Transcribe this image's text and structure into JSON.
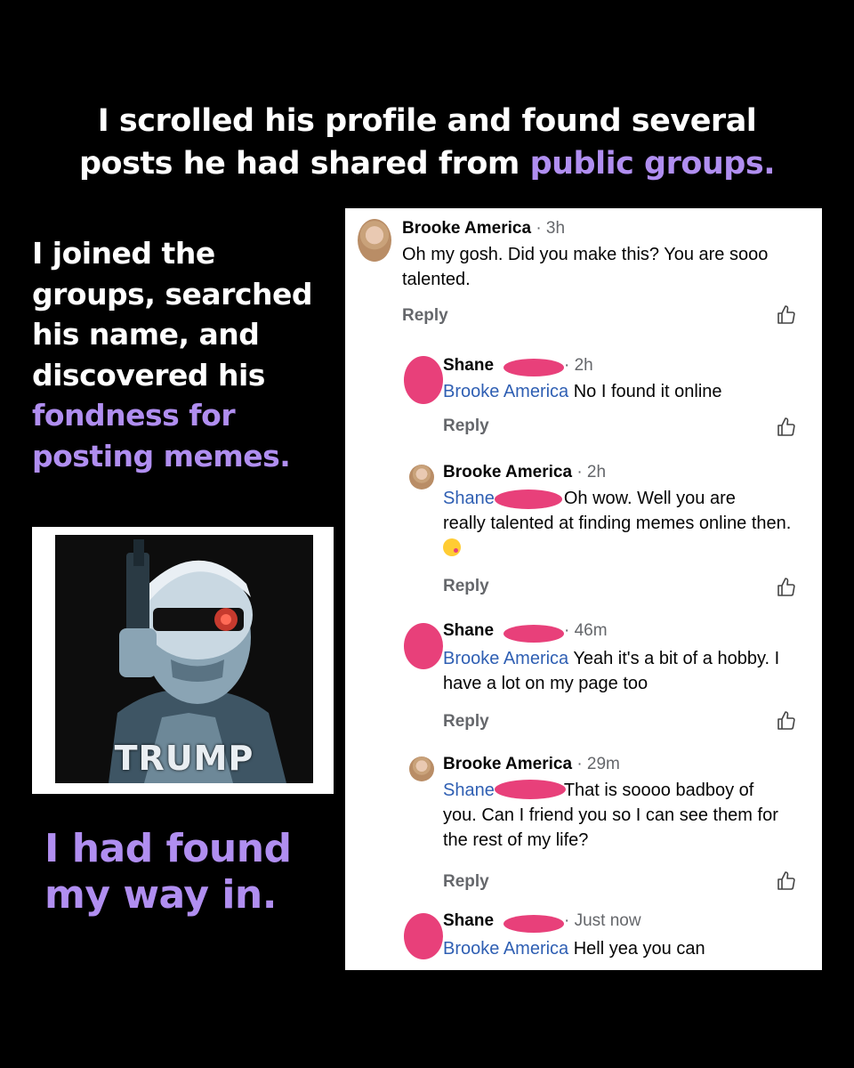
{
  "headline": {
    "line1": "I scrolled his profile and found several",
    "line2_plain": "posts he had shared from ",
    "line2_accent": "public groups."
  },
  "left_text": {
    "plain": "I joined the groups, searched his name, and discovered his ",
    "accent": "fondness for posting memes."
  },
  "closing": "I had found my way in.",
  "meme": {
    "caption": "TRUMP"
  },
  "colors": {
    "accent": "#b08ef0",
    "mention": "#2f5fb3",
    "redaction": "#e8407a"
  },
  "comments": [
    {
      "name": "Brooke America",
      "time": "· 3h",
      "mention": "",
      "text": "Oh my gosh. Did you make this? You are sooo talented.",
      "reply": "Reply",
      "icon": "thumbs-up-icon"
    },
    {
      "name": "Shane",
      "time": "· 2h",
      "mention": "Brooke America",
      "text": "No I found it online",
      "reply": "Reply",
      "icon": "thumbs-up-icon"
    },
    {
      "name": "Brooke America",
      "time": "· 2h",
      "mention": "Shane",
      "text_line1": "Oh wow. Well you are",
      "text_rest": "really talented at finding memes online then.",
      "emoji": "kissing-face-emoji",
      "reply": "Reply",
      "icon": "thumbs-up-icon"
    },
    {
      "name": "Shane",
      "time": "· 46m",
      "mention": "Brooke America",
      "text": "Yeah it's a bit of a hobby. I have a lot on my page too",
      "reply": "Reply",
      "icon": "thumbs-up-icon"
    },
    {
      "name": "Brooke America",
      "time": "· 29m",
      "mention": "Shane",
      "text_line1": "That is soooo badboy of",
      "text_rest": "you. Can I friend you so I can see them for the rest of my life?",
      "reply": "Reply",
      "icon": "thumbs-up-icon"
    },
    {
      "name": "Shane",
      "time": "· Just now",
      "mention": "Brooke America",
      "text": "Hell yea you can"
    }
  ]
}
